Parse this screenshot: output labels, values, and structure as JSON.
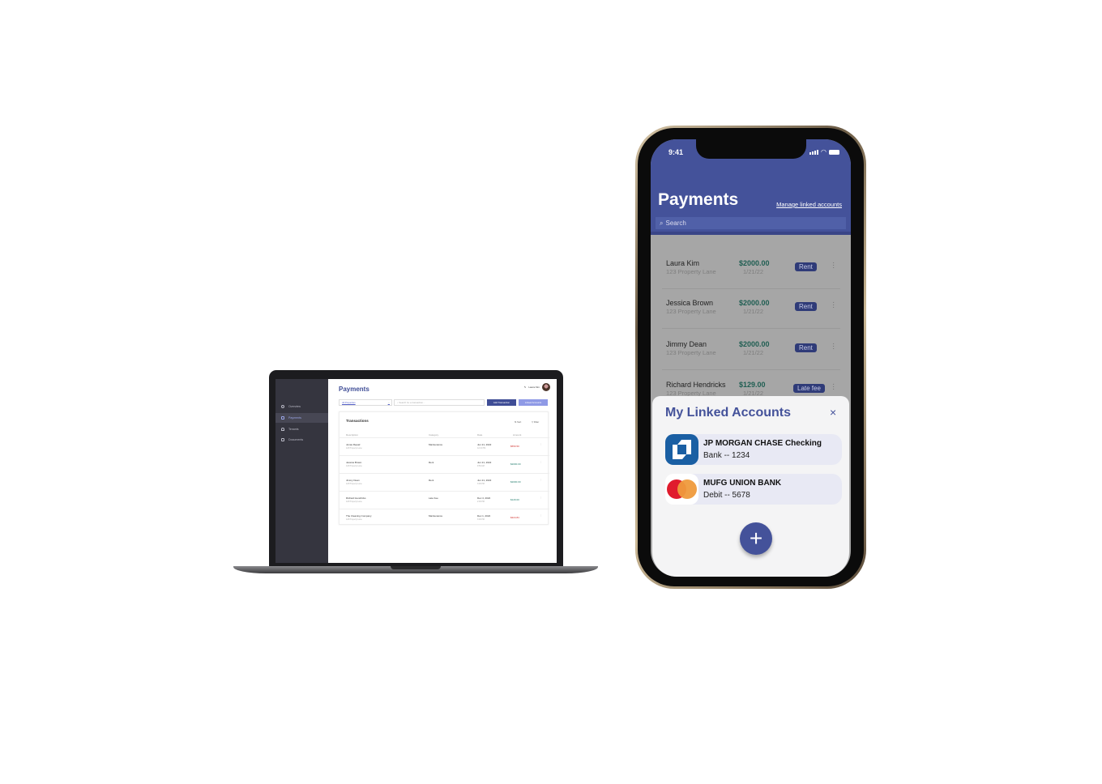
{
  "laptop": {
    "sidebar": [
      "Overview",
      "Payments",
      "Tenants",
      "Documents"
    ],
    "title": "Payments",
    "user": "Laura Kim",
    "filter": "All Properties",
    "search_placeholder": "Search for a transaction...",
    "add_button": "Add Transaction",
    "linked_button": "Linked Accounts",
    "card_title": "Transactions",
    "sort": "Sort",
    "filter_btn": "Filter",
    "headers": [
      "Description",
      "Category",
      "Date",
      "Amount"
    ],
    "rows": [
      {
        "name": "Jonas Repair",
        "addr": "123 Property Lane",
        "category": "Maintenance",
        "date": "Jun 21, 2022",
        "time": "12:21 PM",
        "amount": "$550.50",
        "color": "#d0312d"
      },
      {
        "name": "Jessica Brown",
        "addr": "123 Property Lane",
        "category": "Rent",
        "date": "Jun 21, 2022",
        "time": "9:50 AM",
        "amount": "$2000.00",
        "color": "#1f7a6a"
      },
      {
        "name": "Jimmy Dean",
        "addr": "123 Property Lane",
        "category": "Rent",
        "date": "Jun 21, 2022",
        "time": "3:00 PM",
        "amount": "$2000.00",
        "color": "#1f7a6a"
      },
      {
        "name": "Richard Hendricks",
        "addr": "123 Property Lane",
        "category": "Late Fee",
        "date": "Dec 4, 2022",
        "time": "2:00 PM",
        "amount": "$129.00",
        "color": "#1f7a6a"
      },
      {
        "name": "The Cleaning Company",
        "addr": "123 Property Lane",
        "category": "Maintenance",
        "date": "Dec 1, 2022",
        "time": "3:00 PM",
        "amount": "$324.84",
        "color": "#d0312d"
      }
    ]
  },
  "phone": {
    "time": "9:41",
    "title": "Payments",
    "manage_link": "Manage linked accounts",
    "search_placeholder": "Search",
    "rows": [
      {
        "name": "Laura Kim",
        "addr": "123 Property Lane",
        "amount": "$2000.00",
        "date": "1/21/22",
        "tag": "Rent"
      },
      {
        "name": "Jessica Brown",
        "addr": "123 Property Lane",
        "amount": "$2000.00",
        "date": "1/21/22",
        "tag": "Rent"
      },
      {
        "name": "Jimmy Dean",
        "addr": "123 Property Lane",
        "amount": "$2000.00",
        "date": "1/21/22",
        "tag": "Rent"
      },
      {
        "name": "Richard Hendricks",
        "addr": "123 Property Lane",
        "amount": "$129.00",
        "date": "1/21/22",
        "tag": "Late fee"
      }
    ],
    "sheet": {
      "title": "My Linked Accounts",
      "close": "×",
      "accounts": [
        {
          "name": "JP MORGAN CHASE Checking",
          "sub": "Bank -- 1234"
        },
        {
          "name": "MUFG UNION BANK",
          "sub": "Debit -- 5678"
        }
      ],
      "add": "+"
    }
  },
  "colors": {
    "brand": "#44529a"
  }
}
